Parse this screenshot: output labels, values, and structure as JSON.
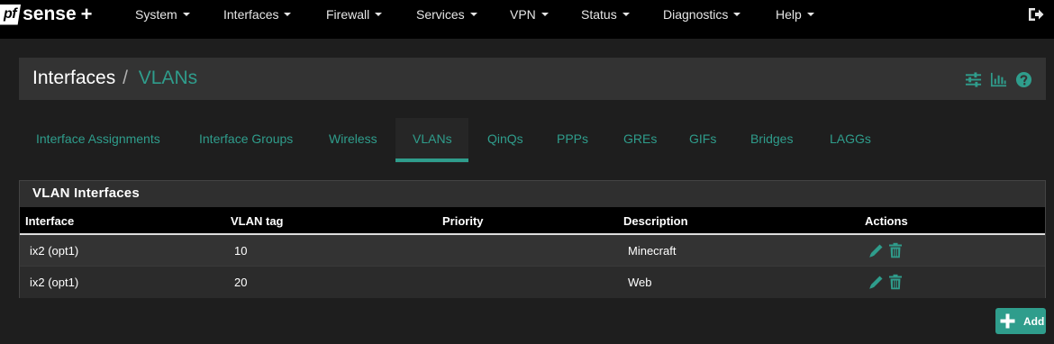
{
  "brand": {
    "logo_pf": "pf",
    "logo_sense": "sense",
    "logo_plus": "+"
  },
  "nav": {
    "items": [
      {
        "label": "System"
      },
      {
        "label": "Interfaces"
      },
      {
        "label": "Firewall"
      },
      {
        "label": "Services"
      },
      {
        "label": "VPN"
      },
      {
        "label": "Status"
      },
      {
        "label": "Diagnostics"
      },
      {
        "label": "Help"
      }
    ],
    "logout_icon": "sign-out-icon"
  },
  "breadcrumb": {
    "parent": "Interfaces",
    "separator": "/",
    "current": "VLANs",
    "icons": [
      "sliders-icon",
      "bar-chart-icon",
      "question-circle-icon"
    ]
  },
  "tabs": [
    {
      "label": "Interface Assignments"
    },
    {
      "label": "Interface Groups"
    },
    {
      "label": "Wireless"
    },
    {
      "label": "VLANs",
      "active": true
    },
    {
      "label": "QinQs"
    },
    {
      "label": "PPPs"
    },
    {
      "label": "GREs"
    },
    {
      "label": "GIFs"
    },
    {
      "label": "Bridges"
    },
    {
      "label": "LAGGs"
    }
  ],
  "panel": {
    "title": "VLAN Interfaces",
    "columns": [
      "Interface",
      "VLAN tag",
      "Priority",
      "Description",
      "Actions"
    ],
    "rows": [
      {
        "interface": "ix2 (opt1)",
        "vlan_tag": "10",
        "priority": "",
        "description": "Minecraft",
        "actions": [
          "edit-icon",
          "trash-icon"
        ]
      },
      {
        "interface": "ix2 (opt1)",
        "vlan_tag": "20",
        "priority": "",
        "description": "Web",
        "actions": [
          "edit-icon",
          "trash-icon"
        ]
      }
    ]
  },
  "add_button": {
    "label": "Add",
    "icon": "plus-icon"
  },
  "colors": {
    "accent": "#2f9d8c",
    "navbar": "#000000",
    "background": "#1e1e1e"
  }
}
